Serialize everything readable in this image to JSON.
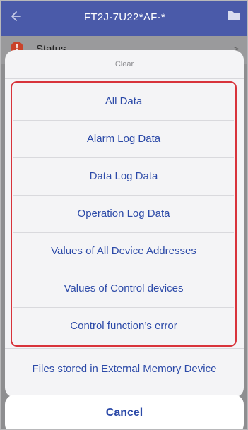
{
  "header": {
    "title": "FT2J-7U22*AF-*",
    "back_icon": "back-arrow-icon",
    "folder_icon": "folder-icon",
    "color": "#4a5aa9"
  },
  "status_row": {
    "label": "Status",
    "badge": "!",
    "chevron": ">"
  },
  "action_sheet": {
    "title": "Clear",
    "highlight_color": "#d8333b",
    "options": [
      {
        "label": "All Data"
      },
      {
        "label": "Alarm Log Data"
      },
      {
        "label": "Data Log Data"
      },
      {
        "label": "Operation Log Data"
      },
      {
        "label": "Values of All Device Addresses"
      },
      {
        "label": "Values of Control devices"
      },
      {
        "label": "Control function’s error"
      }
    ],
    "external_option": "Files stored in External Memory Device",
    "cancel_label": "Cancel"
  }
}
